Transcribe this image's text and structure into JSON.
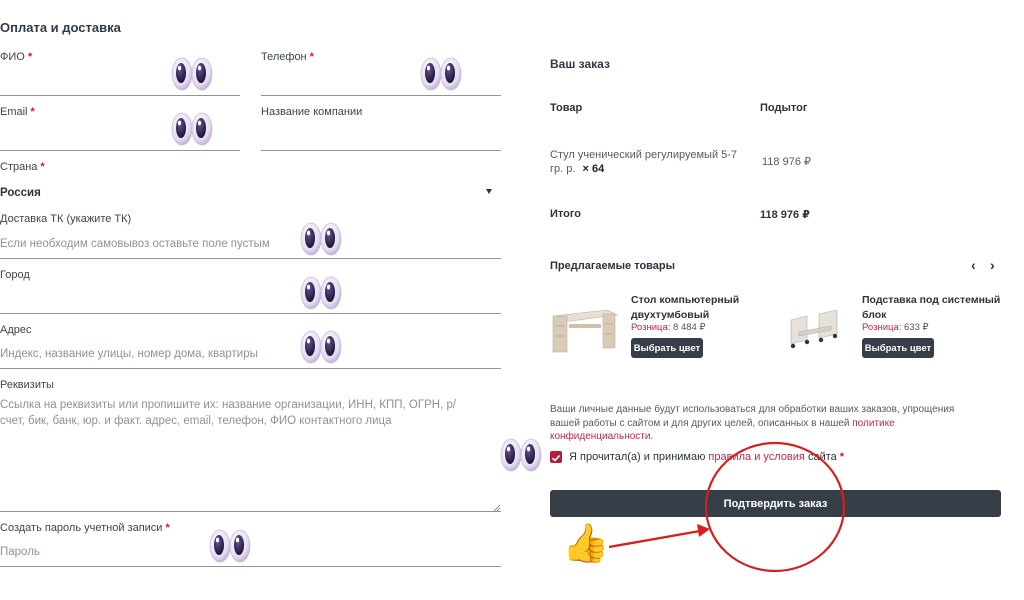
{
  "left": {
    "title": "Оплата и доставка",
    "fio_label": "ФИО",
    "phone_label": "Телефон",
    "email_label": "Email",
    "company_label": "Название компании",
    "country_label": "Страна",
    "country_value": "Россия",
    "delivery_label": "Доставка ТК (укажите ТК)",
    "delivery_placeholder": "Если необходим самовывоз оставьте поле пустым",
    "city_label": "Город",
    "address_label": "Адрес",
    "address_placeholder": "Индекс, название улицы, номер дома, квартиры",
    "requisites_label": "Реквизиты",
    "requisites_placeholder_line1": "Ссылка на реквизиты или пропишите их: название организации, ИНН, КПП, ОГРН, р/",
    "requisites_placeholder_line2": "счет, бик, банк, юр. и факт. адрес, email, телефон, ФИО контактного лица",
    "password_label": "Создать пароль учетной записи",
    "password_placeholder": "Пароль",
    "required_mark": "*"
  },
  "order": {
    "title": "Ваш заказ",
    "col_product": "Товар",
    "col_subtotal": "Подытог",
    "item_name_line1": "Стул ученический регулируемый 5-7",
    "item_name_line2": "гр. р.",
    "item_qty": "× 64",
    "item_price": "118 976 ₽",
    "total_label": "Итого",
    "total_value": "118 976 ₽"
  },
  "suggested": {
    "title": "Предлагаемые товары",
    "prev": "‹",
    "next": "›",
    "products": [
      {
        "name_line1": "Стол компьютерный",
        "name_line2": "двухтумбовый",
        "retail_label": "Розница:",
        "price": "8 484 ₽",
        "button": "Выбрать цвет"
      },
      {
        "name_line1": "Подставка под системный",
        "name_line2": "блок",
        "retail_label": "Розница:",
        "price": "633 ₽",
        "button": "Выбрать цвет"
      }
    ]
  },
  "privacy": {
    "text_line1": "Ваши личные данные будут использоваться для обработки ваших заказов, упрощения",
    "text_line2": "вашей работы с сайтом и для других целей, описанных в нашей",
    "link_word": "политике",
    "link_line2": "конфиденциальности",
    "period": ".",
    "agree_prefix": "Я прочитал(а) и принимаю",
    "agree_link": "правила и условия",
    "agree_suffix": "сайта",
    "agree_checked": true
  },
  "submit_button": "Подтвердить заказ",
  "annotations": {
    "thumb": "👍",
    "arrow_color": "#d42020",
    "circle_color": "#d42020"
  }
}
